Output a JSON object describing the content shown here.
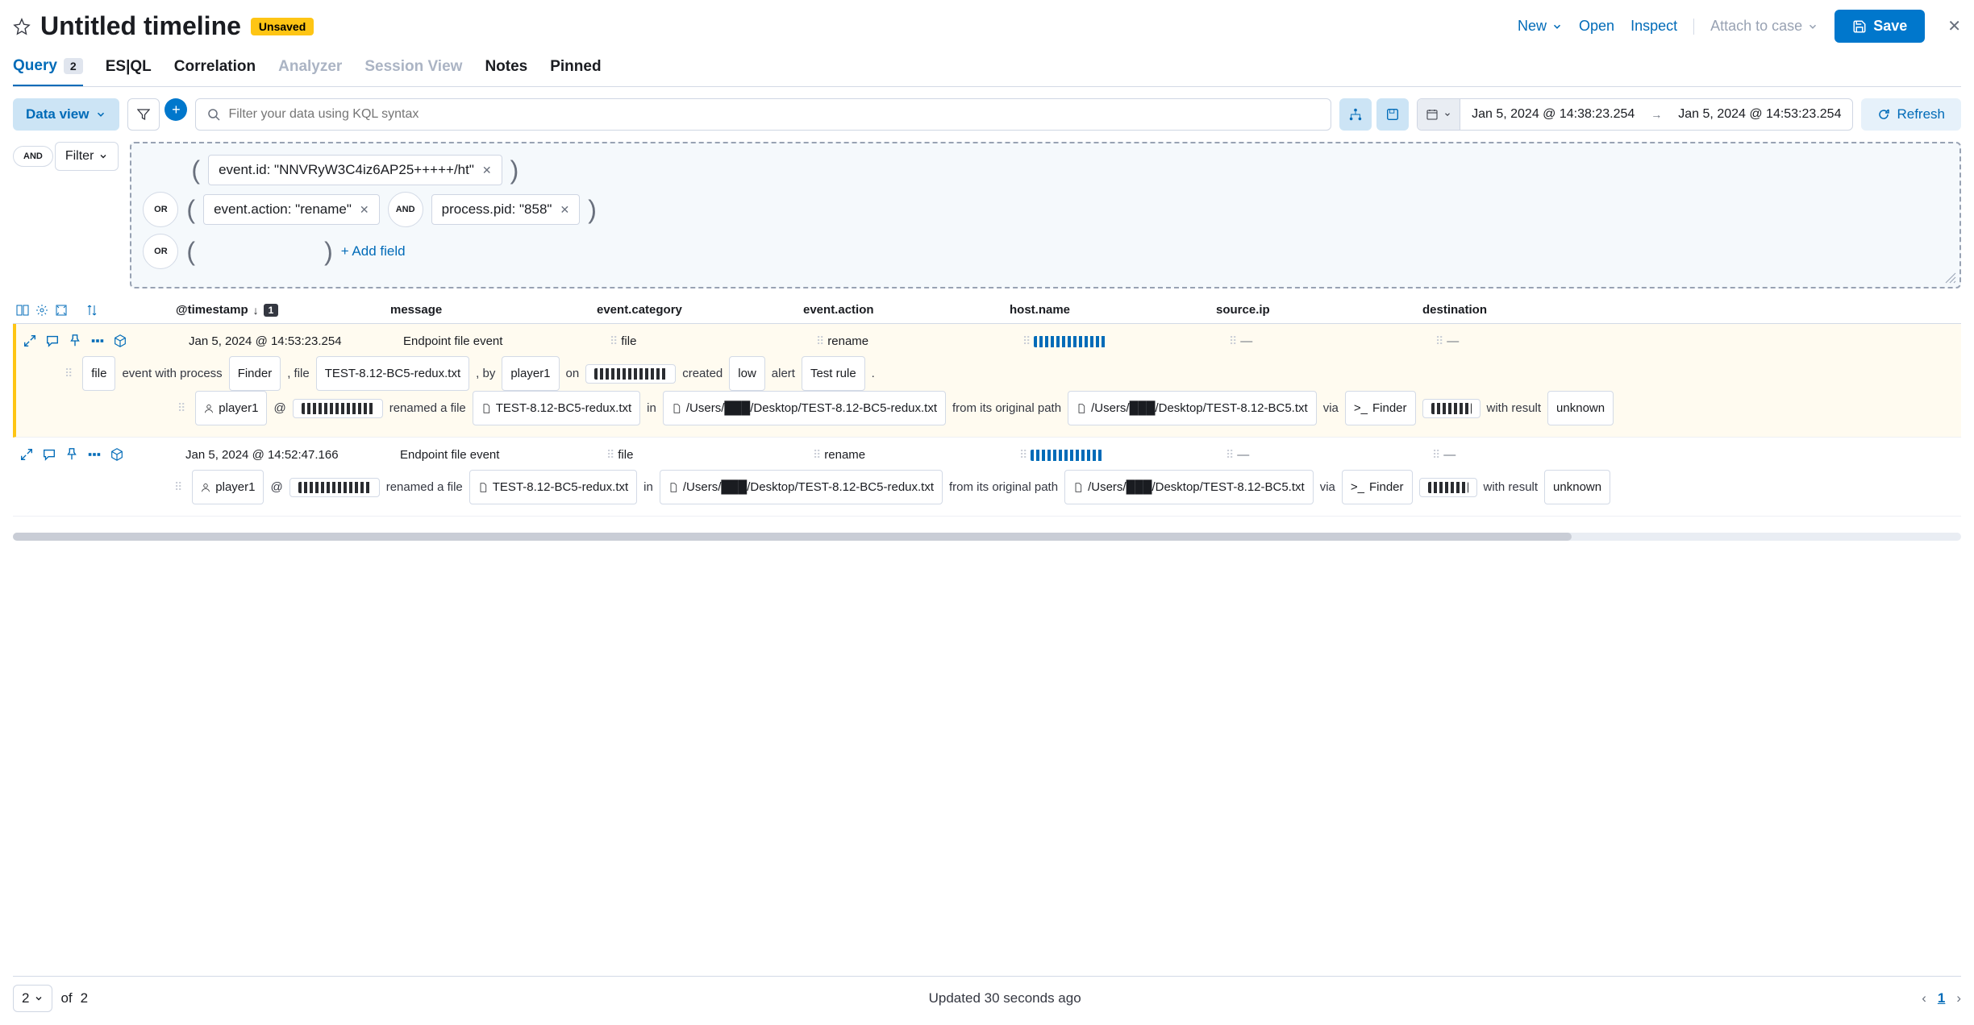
{
  "header": {
    "title": "Untitled timeline",
    "unsaved_badge": "Unsaved",
    "new": "New",
    "open": "Open",
    "inspect": "Inspect",
    "attach": "Attach to case",
    "save": "Save"
  },
  "tabs": {
    "query": "Query",
    "query_count": "2",
    "esql": "ES|QL",
    "correlation": "Correlation",
    "analyzer": "Analyzer",
    "session": "Session View",
    "notes": "Notes",
    "pinned": "Pinned"
  },
  "controls": {
    "data_view": "Data view",
    "kql_placeholder": "Filter your data using KQL syntax",
    "date_from": "Jan 5, 2024 @ 14:38:23.254",
    "date_to": "Jan 5, 2024 @ 14:53:23.254",
    "refresh": "Refresh"
  },
  "filter_bar": {
    "and": "AND",
    "filter": "Filter"
  },
  "query_builder": {
    "or": "OR",
    "and": "AND",
    "pill1": "event.id: \"NNVRyW3C4iz6AP25+++++/ht\"",
    "pill2": "event.action: \"rename\"",
    "pill3": "process.pid: \"858\"",
    "add_field": "+ Add field"
  },
  "columns": {
    "timestamp": "@timestamp",
    "sort_badge": "1",
    "message": "message",
    "category": "event.category",
    "action": "event.action",
    "host": "host.name",
    "source": "source.ip",
    "dest": "destination"
  },
  "rows": [
    {
      "timestamp": "Jan 5, 2024 @ 14:53:23.254",
      "message": "Endpoint file event",
      "category": "file",
      "action": "rename",
      "source": "—",
      "dest": "—",
      "detail1": {
        "file": "file",
        "txt1": "event with process",
        "finder": "Finder",
        "txt2": ", file",
        "filename": "TEST-8.12-BC5-redux.txt",
        "txt3": ", by",
        "user": "player1",
        "txt4": "on",
        "txt5": "created",
        "low": "low",
        "txt6": "alert",
        "rule": "Test rule",
        "dot": "."
      },
      "detail2": {
        "user": "player1",
        "at": "@",
        "txt1": "renamed a file",
        "filename": "TEST-8.12-BC5-redux.txt",
        "txt2": "in",
        "path1": "/Users/███/Desktop/TEST-8.12-BC5-redux.txt",
        "txt3": "from its original path",
        "path2": "/Users/███/Desktop/TEST-8.12-BC5.txt",
        "txt4": "via",
        "finder": "Finder",
        "txt5": "with result",
        "unknown": "unknown"
      }
    },
    {
      "timestamp": "Jan 5, 2024 @ 14:52:47.166",
      "message": "Endpoint file event",
      "category": "file",
      "action": "rename",
      "source": "—",
      "dest": "—",
      "detail2": {
        "user": "player1",
        "at": "@",
        "txt1": "renamed a file",
        "filename": "TEST-8.12-BC5-redux.txt",
        "txt2": "in",
        "path1": "/Users/███/Desktop/TEST-8.12-BC5-redux.txt",
        "txt3": "from its original path",
        "path2": "/Users/███/Desktop/TEST-8.12-BC5.txt",
        "txt4": "via",
        "finder": "Finder",
        "txt5": "with result",
        "unknown": "unknown"
      }
    }
  ],
  "footer": {
    "per_page": "2",
    "of": "of",
    "total": "2",
    "updated": "Updated 30 seconds ago",
    "current_page": "1"
  }
}
